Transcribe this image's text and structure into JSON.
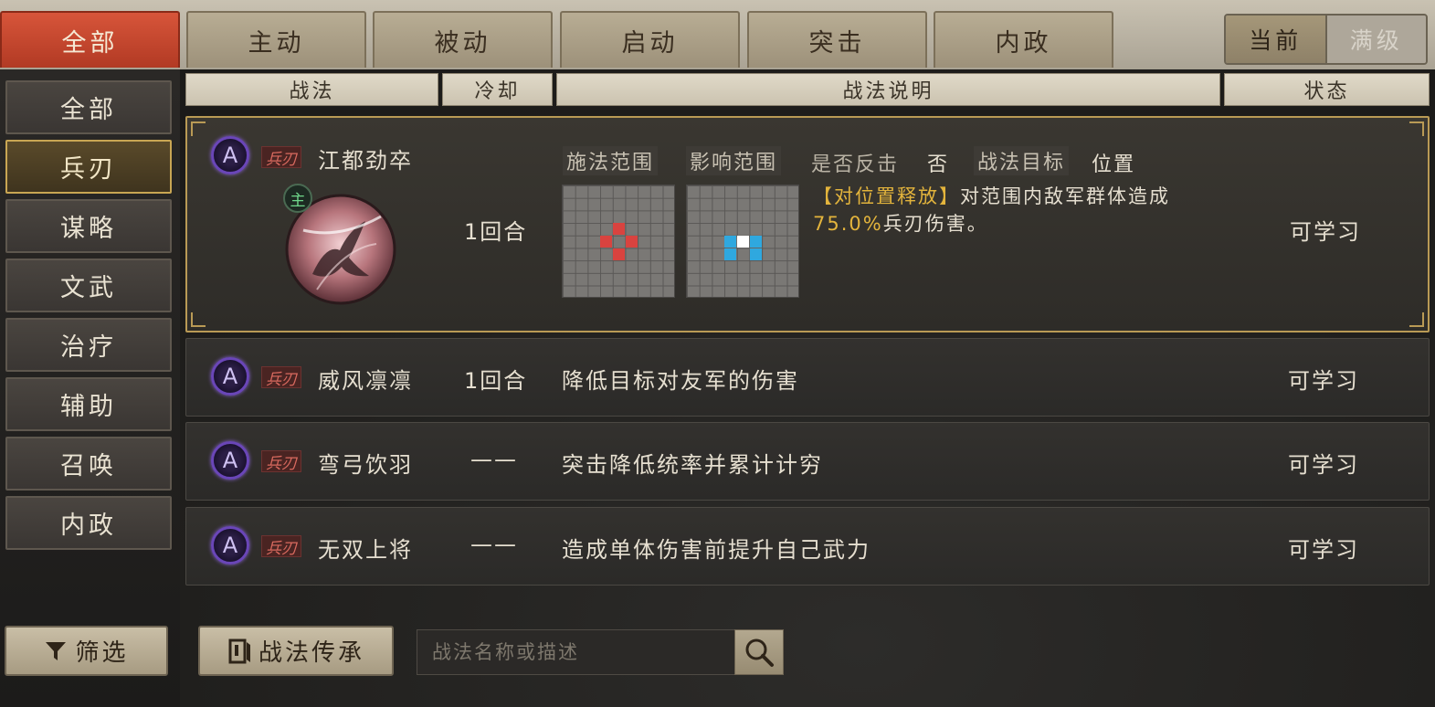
{
  "top_tabs": [
    {
      "label": "全部",
      "active": true
    },
    {
      "label": "主动"
    },
    {
      "label": "被动"
    },
    {
      "label": "启动"
    },
    {
      "label": "突击"
    },
    {
      "label": "内政"
    }
  ],
  "level_toggle": {
    "current": "当前",
    "max": "满级",
    "selected": "current"
  },
  "sidebar": [
    "全部",
    "兵刃",
    "谋略",
    "文武",
    "治疗",
    "辅助",
    "召唤",
    "内政"
  ],
  "sidebar_active_index": 1,
  "table_headers": {
    "skill": "战法",
    "cooldown": "冷却",
    "description": "战法说明",
    "status": "状态"
  },
  "expanded": {
    "grade": "A",
    "type_tag": "兵刃",
    "name": "江都劲卒",
    "main_badge": "主",
    "cooldown": "1回合",
    "cast_range_label": "施法范围",
    "effect_range_label": "影响范围",
    "counter_label": "是否反击",
    "counter_value": "否",
    "target_label": "战法目标",
    "target_value": "位置",
    "desc_prefix": "【对位置释放】",
    "desc_main": "对范围内敌军群体造成",
    "desc_value": "75.0%",
    "desc_suffix": "兵刃伤害。",
    "status": "可学习",
    "colors": {
      "cast": "#d9433f",
      "effect": "#2fa8df",
      "effect_center": "#ffffff",
      "highlight": "#e3b43c"
    }
  },
  "rows": [
    {
      "grade": "A",
      "type_tag": "兵刃",
      "name": "威风凛凛",
      "cooldown": "1回合",
      "description": "降低目标对友军的伤害",
      "status": "可学习"
    },
    {
      "grade": "A",
      "type_tag": "兵刃",
      "name": "弯弓饮羽",
      "cooldown": "——",
      "description": "突击降低统率并累计计穷",
      "status": "可学习"
    },
    {
      "grade": "A",
      "type_tag": "兵刃",
      "name": "无双上将",
      "cooldown": "——",
      "description": "造成单体伤害前提升自己武力",
      "status": "可学习"
    }
  ],
  "filter_button": "筛选",
  "inherit_button": "战法传承",
  "search_placeholder": "战法名称或描述"
}
